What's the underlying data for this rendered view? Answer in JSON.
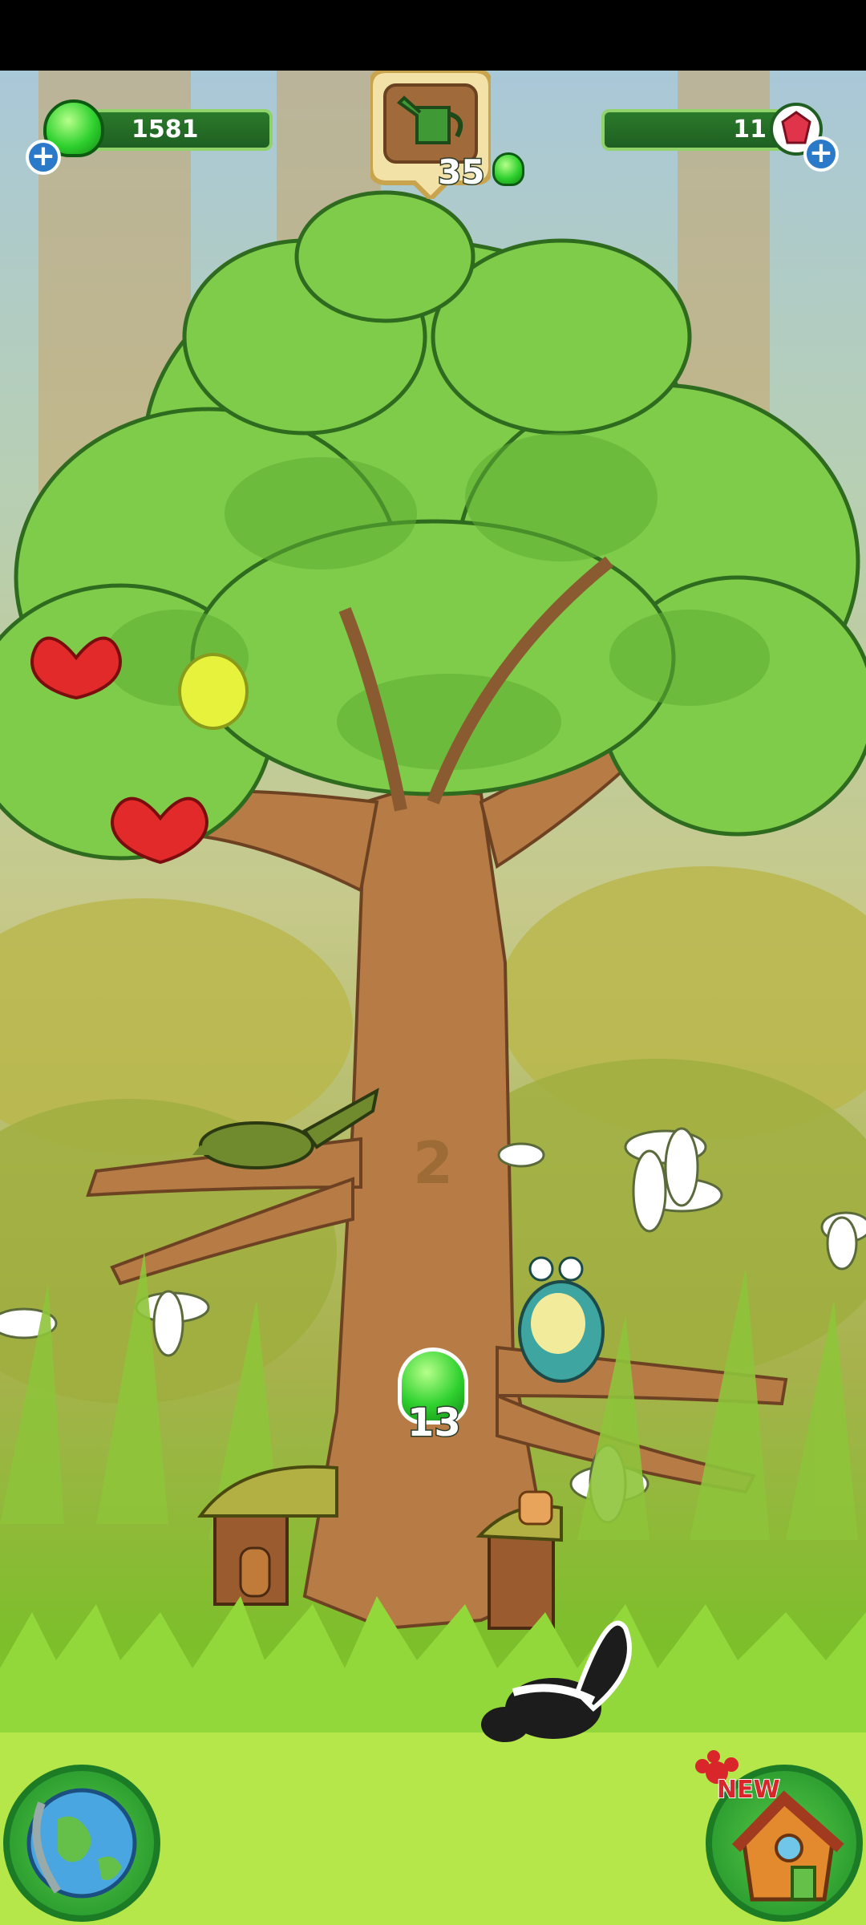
{
  "hud": {
    "gems": {
      "value": "1581",
      "icon": "green-gem-icon",
      "plus_icon": "plus-icon"
    },
    "rubies": {
      "value": "11",
      "icon": "ruby-icon",
      "plus_icon": "plus-icon"
    },
    "watering": {
      "icon": "watering-can-icon",
      "value": "35",
      "currency_icon": "green-gem-icon"
    }
  },
  "tree": {
    "level": "2",
    "drop": {
      "icon": "green-gem-icon",
      "value": "13"
    }
  },
  "buttons": {
    "world": {
      "icon": "globe-icon"
    },
    "house": {
      "icon": "house-icon",
      "badge": "NEW"
    }
  },
  "colors": {
    "hud_green": "#1f5f22",
    "gem_green": "#2fd12f",
    "plus_blue": "#2b79c9",
    "new_red": "#d8262b"
  }
}
